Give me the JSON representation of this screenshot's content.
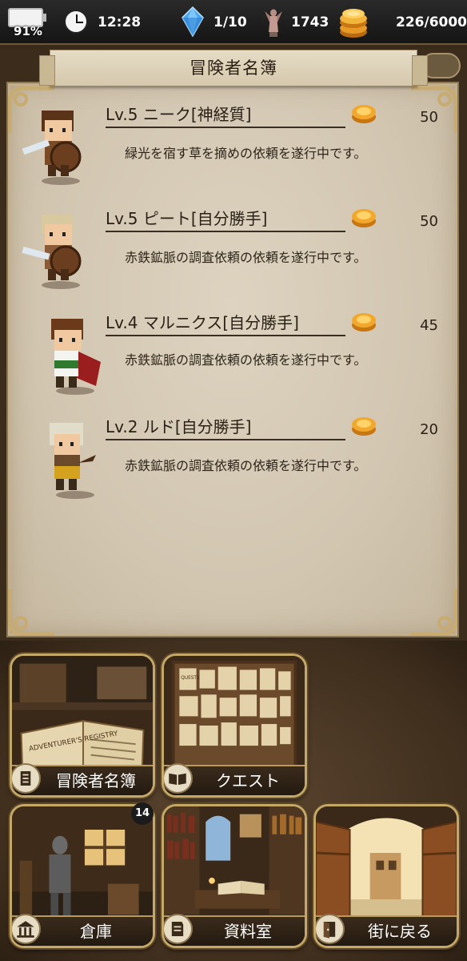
{
  "status_bar": {
    "battery": "91%",
    "time": "12:28",
    "gems": "1/10",
    "renown": "1743",
    "gold": "226/6000"
  },
  "roster": {
    "title": "冒険者名簿",
    "adventurers": [
      {
        "name": "Lv.5 ニーク[神経質]",
        "status": "緑光を宿す草を摘めの依頼を遂行中です。",
        "reward": "50"
      },
      {
        "name": "Lv.5 ピート[自分勝手]",
        "status": "赤鉄鉱脈の調査依頼の依頼を遂行中です。",
        "reward": "50"
      },
      {
        "name": "Lv.4 マルニクス[自分勝手]",
        "status": "赤鉄鉱脈の調査依頼の依頼を遂行中です。",
        "reward": "45"
      },
      {
        "name": "Lv.2 ルド[自分勝手]",
        "status": "赤鉄鉱脈の調査依頼の依頼を遂行中です。",
        "reward": "20"
      }
    ]
  },
  "menu": {
    "roster_label": "冒険者名簿",
    "roster_book_text": "ADVENTURER'S REGISTRY",
    "quest_label": "クエスト",
    "quest_board_text": "QUESTS",
    "storage_label": "倉庫",
    "storage_badge": "14",
    "library_label": "資料室",
    "town_label": "街に戻る"
  }
}
